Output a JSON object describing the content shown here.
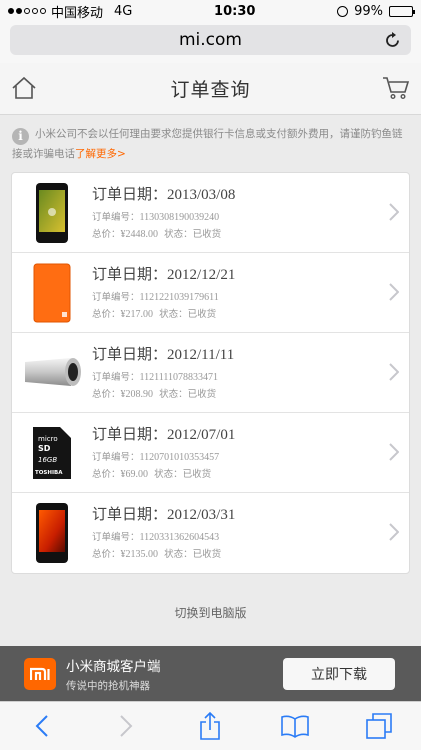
{
  "status": {
    "carrier": "中国移动",
    "network": "4G",
    "time": "10:30",
    "battery": "99%",
    "battery_level": 0.99
  },
  "browser": {
    "url": "mi.com"
  },
  "header": {
    "title": "订单查询"
  },
  "notice": {
    "text": "小米公司不会以任何理由要求您提供银行卡信息或支付额外费用，请谨防钓鱼链接或诈骗电话",
    "link": "了解更多>"
  },
  "labels": {
    "date": "订单日期：",
    "order_no": "订单编号：",
    "total": "总价：",
    "status": "状态："
  },
  "orders": [
    {
      "date": "2013/03/08",
      "order_no": "1130308190039240",
      "total": "¥2448.00",
      "status": "已收货",
      "product_icon": "phone-icon"
    },
    {
      "date": "2012/12/21",
      "order_no": "1121221039179611",
      "total": "¥217.00",
      "status": "已收货",
      "product_icon": "battery-case-icon"
    },
    {
      "date": "2012/11/11",
      "order_no": "1121111078833471",
      "total": "¥208.90",
      "status": "已收货",
      "product_icon": "power-bank-icon"
    },
    {
      "date": "2012/07/01",
      "order_no": "1120701010353457",
      "total": "¥69.00",
      "status": "已收货",
      "product_icon": "microsd-card-icon"
    },
    {
      "date": "2012/03/31",
      "order_no": "1120331362604543",
      "total": "¥2135.00",
      "status": "已收货",
      "product_icon": "phone-icon"
    }
  ],
  "footer": {
    "switch_pc": "切换到电脑版"
  },
  "download": {
    "logo": "mi",
    "title": "小米商城客户端",
    "subtitle": "传说中的抢机神器",
    "button": "立即下载"
  },
  "colors": {
    "accent": "#ff6700",
    "toolbar_blue": "#2b7cf6"
  }
}
